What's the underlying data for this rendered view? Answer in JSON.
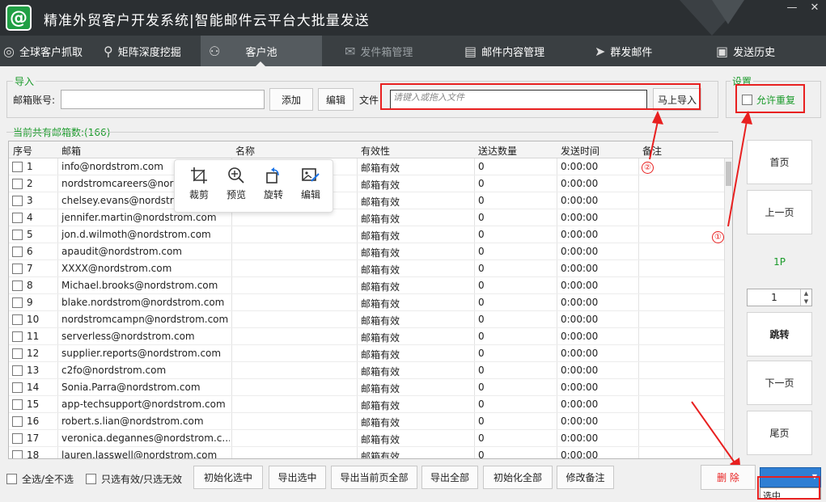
{
  "app": {
    "title": "精准外贸客户开发系统|智能邮件云平台大批量发送",
    "logo_icon": "at-icon"
  },
  "nav": {
    "tabs": [
      {
        "label": "全球客户抓取",
        "icon": "globe-icon"
      },
      {
        "label": "矩阵深度挖掘",
        "icon": "search-icon"
      },
      {
        "label": "客户池",
        "icon": "users-icon"
      },
      {
        "label": "发件箱管理",
        "icon": "mail-icon"
      },
      {
        "label": "邮件内容管理",
        "icon": "document-icon"
      },
      {
        "label": "群发邮件",
        "icon": "send-icon"
      },
      {
        "label": "发送历史",
        "icon": "history-icon"
      }
    ]
  },
  "import": {
    "group_label": "导入",
    "account_label": "邮箱账号:",
    "account_value": "",
    "add_button": "添加",
    "edit_button": "编辑",
    "file_label": "文件",
    "file_placeholder": "请键入或拖入文件",
    "import_button": "马上导入"
  },
  "settings": {
    "group_label": "设置",
    "allow_dup_label": "允许重复"
  },
  "list": {
    "count_label": "当前共有邮箱数:(166)",
    "columns": [
      "序号",
      "邮箱",
      "名称",
      "有效性",
      "送达数量",
      "发送时间",
      "备注"
    ],
    "rows": [
      {
        "no": "1",
        "email": "info@nordstrom.com",
        "name": "",
        "validity": "邮箱有效",
        "count": "0",
        "time": "0:00:00",
        "note": ""
      },
      {
        "no": "2",
        "email": "nordstromcareers@nordstrom.com",
        "name": "",
        "validity": "邮箱有效",
        "count": "0",
        "time": "0:00:00",
        "note": ""
      },
      {
        "no": "3",
        "email": "chelsey.evans@nordstrom.com",
        "name": "",
        "validity": "邮箱有效",
        "count": "0",
        "time": "0:00:00",
        "note": ""
      },
      {
        "no": "4",
        "email": "jennifer.martin@nordstrom.com",
        "name": "",
        "validity": "邮箱有效",
        "count": "0",
        "time": "0:00:00",
        "note": ""
      },
      {
        "no": "5",
        "email": "jon.d.wilmoth@nordstrom.com",
        "name": "",
        "validity": "邮箱有效",
        "count": "0",
        "time": "0:00:00",
        "note": ""
      },
      {
        "no": "6",
        "email": "apaudit@nordstrom.com",
        "name": "",
        "validity": "邮箱有效",
        "count": "0",
        "time": "0:00:00",
        "note": ""
      },
      {
        "no": "7",
        "email": "XXXX@nordstrom.com",
        "name": "",
        "validity": "邮箱有效",
        "count": "0",
        "time": "0:00:00",
        "note": ""
      },
      {
        "no": "8",
        "email": "Michael.brooks@nordstrom.com",
        "name": "",
        "validity": "邮箱有效",
        "count": "0",
        "time": "0:00:00",
        "note": ""
      },
      {
        "no": "9",
        "email": "blake.nordstrom@nordstrom.com",
        "name": "",
        "validity": "邮箱有效",
        "count": "0",
        "time": "0:00:00",
        "note": ""
      },
      {
        "no": "10",
        "email": "nordstromcampn@nordstrom.com",
        "name": "",
        "validity": "邮箱有效",
        "count": "0",
        "time": "0:00:00",
        "note": ""
      },
      {
        "no": "11",
        "email": "serverless@nordstrom.com",
        "name": "",
        "validity": "邮箱有效",
        "count": "0",
        "time": "0:00:00",
        "note": ""
      },
      {
        "no": "12",
        "email": "supplier.reports@nordstrom.com",
        "name": "",
        "validity": "邮箱有效",
        "count": "0",
        "time": "0:00:00",
        "note": ""
      },
      {
        "no": "13",
        "email": "c2fo@nordstrom.com",
        "name": "",
        "validity": "邮箱有效",
        "count": "0",
        "time": "0:00:00",
        "note": ""
      },
      {
        "no": "14",
        "email": "Sonia.Parra@nordstrom.com",
        "name": "",
        "validity": "邮箱有效",
        "count": "0",
        "time": "0:00:00",
        "note": ""
      },
      {
        "no": "15",
        "email": "app-techsupport@nordstrom.com",
        "name": "",
        "validity": "邮箱有效",
        "count": "0",
        "time": "0:00:00",
        "note": ""
      },
      {
        "no": "16",
        "email": "robert.s.lian@nordstrom.com",
        "name": "",
        "validity": "邮箱有效",
        "count": "0",
        "time": "0:00:00",
        "note": ""
      },
      {
        "no": "17",
        "email": "veronica.degannes@nordstrom.c...",
        "name": "",
        "validity": "邮箱有效",
        "count": "0",
        "time": "0:00:00",
        "note": ""
      },
      {
        "no": "18",
        "email": "lauren.lasswell@nordstrom.com",
        "name": "",
        "validity": "邮箱有效",
        "count": "0",
        "time": "0:00:00",
        "note": ""
      }
    ]
  },
  "popup": {
    "items": [
      {
        "label": "裁剪",
        "icon": "crop-icon"
      },
      {
        "label": "预览",
        "icon": "zoom-in-icon"
      },
      {
        "label": "旋转",
        "icon": "rotate-icon"
      },
      {
        "label": "编辑",
        "icon": "image-edit-icon"
      }
    ]
  },
  "pager": {
    "first": "首页",
    "prev": "上一页",
    "page": "1P",
    "page_input": "1",
    "jump": "跳转",
    "next": "下一页",
    "last": "尾页"
  },
  "footer": {
    "select_all": "全选/全不选",
    "select_valid": "只选有效/只选无效",
    "init_selected": "初始化选中",
    "export_selected": "导出选中",
    "export_page": "导出当前页全部",
    "export_all": "导出全部",
    "init_all": "初始化全部",
    "edit_note": "修改备注",
    "delete": "删 除",
    "dropdown_option": "选中"
  },
  "annotations": {
    "marker1": "①",
    "marker2": "②"
  },
  "colors": {
    "title_bg": "#2b2f32",
    "nav_bg": "#3a3f42",
    "active_tab": "#555b5f",
    "group_green": "#1a9a2a",
    "annotation_red": "#e82020"
  }
}
